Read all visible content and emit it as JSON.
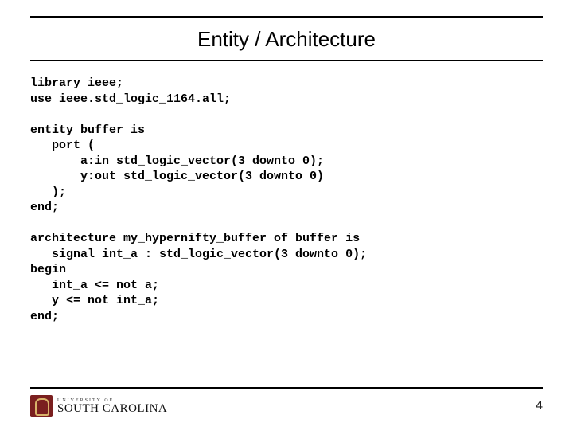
{
  "title": "Entity / Architecture",
  "code": "library ieee;\nuse ieee.std_logic_1164.all;\n\nentity buffer is\n   port (\n       a:in std_logic_vector(3 downto 0);\n       y:out std_logic_vector(3 downto 0)\n   );\nend;\n\narchitecture my_hypernifty_buffer of buffer is\n   signal int_a : std_logic_vector(3 downto 0);\nbegin\n   int_a <= not a;\n   y <= not int_a;\nend;",
  "footer": {
    "logo_university_of": "UNIVERSITY OF",
    "logo_main": "SOUTH CAROLINA",
    "page_number": "4"
  }
}
